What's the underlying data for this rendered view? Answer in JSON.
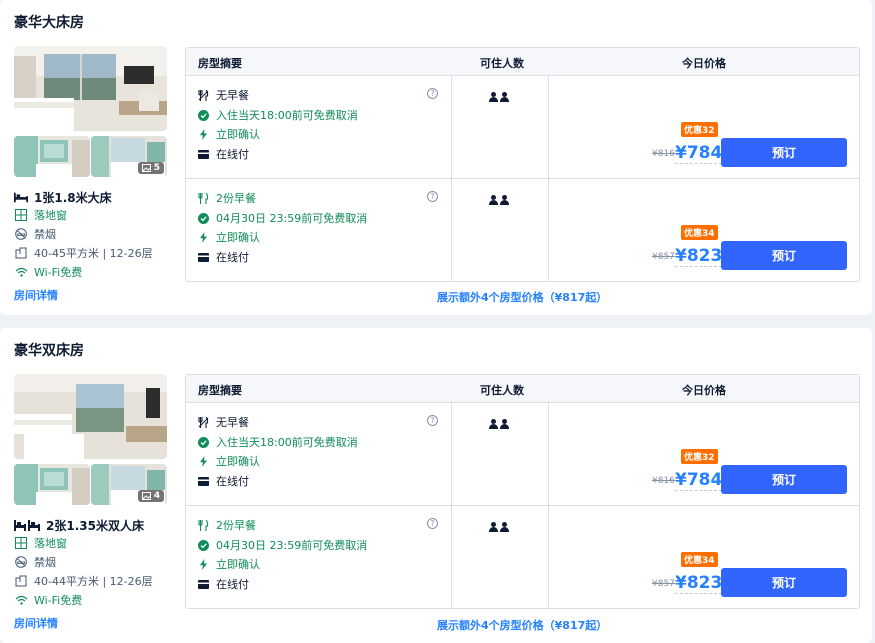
{
  "colors": {
    "accent": "#3264ff",
    "link": "#2681ff",
    "green": "#0f8c5a",
    "badge": "#ff6f00"
  },
  "table_headers": {
    "summary": "房型摘要",
    "guests": "可住人数",
    "price": "今日价格"
  },
  "rooms": [
    {
      "title": "豪华大床房",
      "photo_count": "5",
      "bed": "1张1.8米大床",
      "window": "落地窗",
      "smoking": "禁烟",
      "area_floor": "40-45平方米 | 12-26层",
      "wifi": "Wi-Fi免费",
      "details_link": "房间详情",
      "more_link": "展示额外4个房型价格（¥817起）",
      "rates": [
        {
          "meal": "无早餐",
          "cancel": "入住当天18:00前可免费取消",
          "confirm": "立即确认",
          "payment": "在线付",
          "badge": "优惠32",
          "old_price": "¥816",
          "price": "¥784",
          "book": "预订"
        },
        {
          "meal": "2份早餐",
          "cancel": "04月30日 23:59前可免费取消",
          "confirm": "立即确认",
          "payment": "在线付",
          "badge": "优惠34",
          "old_price": "¥857",
          "price": "¥823",
          "book": "预订"
        }
      ]
    },
    {
      "title": "豪华双床房",
      "photo_count": "4",
      "bed": "2张1.35米双人床",
      "window": "落地窗",
      "smoking": "禁烟",
      "area_floor": "40-44平方米 | 12-26层",
      "wifi": "Wi-Fi免费",
      "details_link": "房间详情",
      "more_link": "展示额外4个房型价格（¥817起）",
      "rates": [
        {
          "meal": "无早餐",
          "cancel": "入住当天18:00前可免费取消",
          "confirm": "立即确认",
          "payment": "在线付",
          "badge": "优惠32",
          "old_price": "¥816",
          "price": "¥784",
          "book": "预订"
        },
        {
          "meal": "2份早餐",
          "cancel": "04月30日 23:59前可免费取消",
          "confirm": "立即确认",
          "payment": "在线付",
          "badge": "优惠34",
          "old_price": "¥857",
          "price": "¥823",
          "book": "预订"
        }
      ]
    }
  ]
}
